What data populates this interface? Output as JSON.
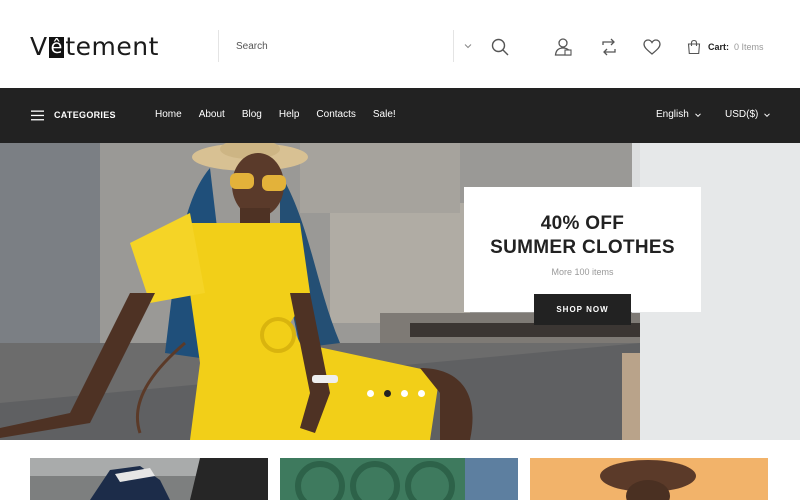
{
  "header": {
    "logo_text": "Vêtement",
    "search": {
      "placeholder": "Search",
      "value": ""
    },
    "icons": {
      "search": "search-icon",
      "account": "user-icon",
      "compare": "compare-icon",
      "wishlist": "heart-icon",
      "cart": "shopping-bag-icon"
    },
    "cart": {
      "label": "Cart:",
      "count": "0 Items"
    }
  },
  "nav": {
    "categories_label": "CATEGORIES",
    "links": [
      {
        "label": "Home"
      },
      {
        "label": "About"
      },
      {
        "label": "Blog"
      },
      {
        "label": "Help"
      },
      {
        "label": "Contacts"
      },
      {
        "label": "Sale!"
      }
    ],
    "language": "English",
    "currency": "USD($)"
  },
  "hero": {
    "promo_line1": "40% OFF",
    "promo_line2": "SUMMER CLOTHES",
    "promo_sub": "More 100 items",
    "cta_label": "SHOP NOW",
    "slide_count": 4,
    "active_slide": 2
  },
  "colors": {
    "nav_bg": "#222222",
    "accent_yellow": "#f2cf18",
    "text_dark": "#222222",
    "muted": "#999999"
  }
}
